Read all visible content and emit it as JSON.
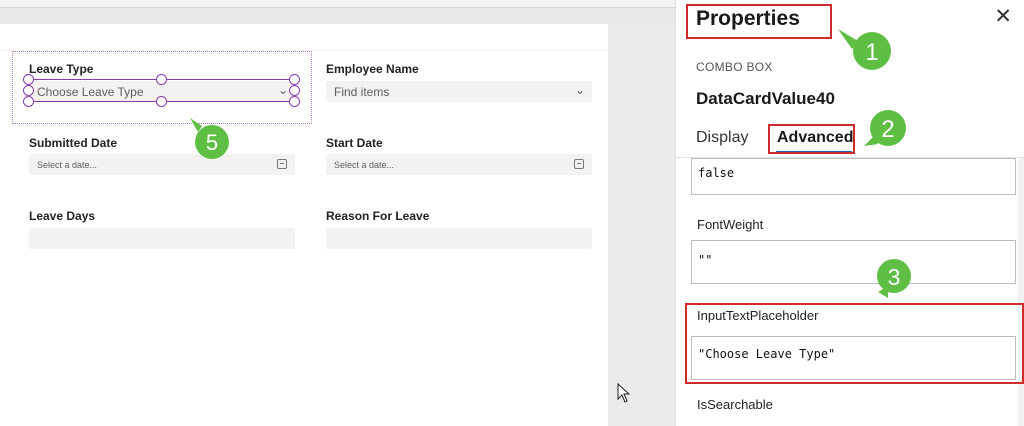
{
  "form": {
    "fields": [
      {
        "label": "Leave Type",
        "placeholder": "Choose Leave Type"
      },
      {
        "label": "Employee Name",
        "placeholder": "Find items"
      },
      {
        "label": "Submitted Date",
        "placeholder": "Select a date..."
      },
      {
        "label": "Start Date",
        "placeholder": "Select a date..."
      },
      {
        "label": "Leave Days",
        "placeholder": ""
      },
      {
        "label": "Reason For Leave",
        "placeholder": ""
      }
    ]
  },
  "properties_panel": {
    "title": "Properties",
    "control_type": "COMBO BOX",
    "control_name": "DataCardValue40",
    "tabs": [
      {
        "label": "Display",
        "active": false
      },
      {
        "label": "Advanced",
        "active": true
      }
    ],
    "properties": [
      {
        "name": "",
        "value": "false"
      },
      {
        "name": "FontWeight",
        "value": "\"\""
      },
      {
        "name": "InputTextPlaceholder",
        "value": "\"Choose Leave Type\""
      },
      {
        "name": "IsSearchable",
        "value": ""
      }
    ]
  },
  "annotations": {
    "badges": [
      "1",
      "2",
      "3",
      "5"
    ],
    "badge_color": "#5fbf45",
    "highlight_color": "#d02a2a"
  },
  "colors": {
    "selection": "#8a3bb0",
    "accent": "#0f6cbd",
    "input_bg": "#f3f2f1"
  }
}
